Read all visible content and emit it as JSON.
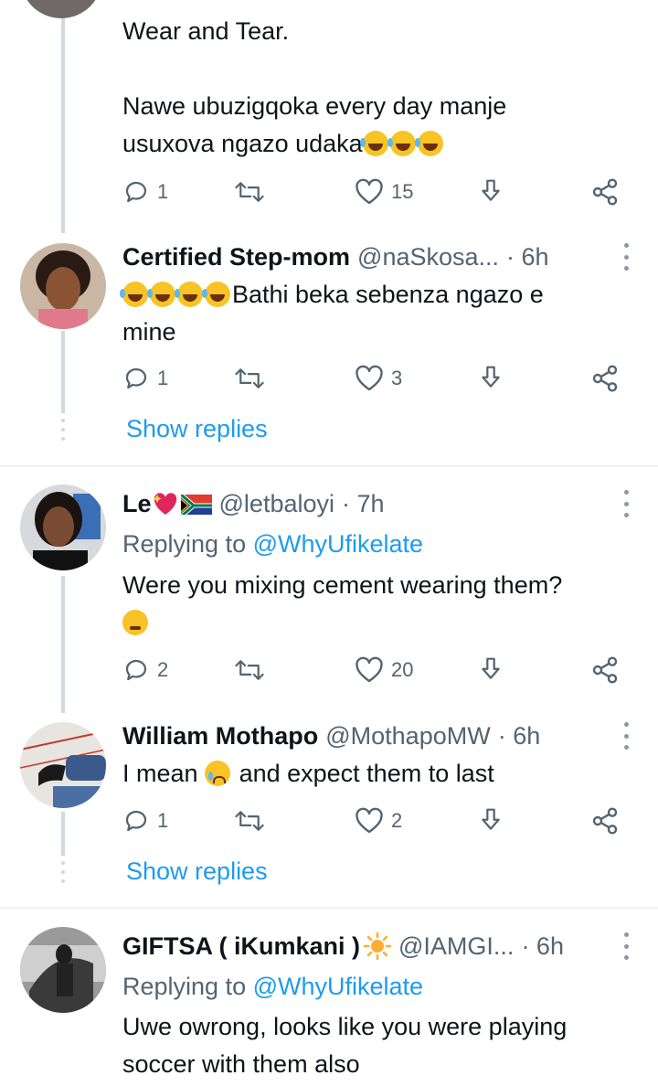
{
  "tweets": [
    {
      "body_lines": [
        "Wear and Tear.",
        "",
        "Nawe ubuzigqoka every day manje",
        "usuxova ngazo udaka"
      ],
      "emoji": [
        "rolling-laughing",
        "rolling-laughing",
        "rolling-laughing"
      ],
      "replies": "1",
      "retweets": "",
      "likes": "15"
    },
    {
      "name": "Certified Step-mom",
      "handle": "@naSkosa...",
      "time": "· 6h",
      "body_emoji": [
        "tears-of-joy",
        "tears-of-joy",
        "tears-of-joy",
        "tears-of-joy"
      ],
      "body_lines": [
        "Bathi beka sebenza ngazo e",
        "mine"
      ],
      "replies": "1",
      "retweets": "",
      "likes": "3",
      "show_replies": "Show replies"
    },
    {
      "name": "Le",
      "handle": "@letbaloyi",
      "time": "· 7h",
      "name_icons": [
        "sparkling-heart",
        "south-africa-flag"
      ],
      "replying_prefix": "Replying to",
      "replying_to": "@WhyUfikelate",
      "body_lines": [
        "Were you mixing cement wearing them?"
      ],
      "body_emoji": [
        "thinking-face"
      ],
      "replies": "2",
      "retweets": "",
      "likes": "20"
    },
    {
      "name": "William Mothapo",
      "handle": "@MothapoMW",
      "time": "· 6h",
      "body_before": "I mean",
      "body_emoji": [
        "crying-face"
      ],
      "body_after": "and expect them to last",
      "replies": "1",
      "retweets": "",
      "likes": "2",
      "show_replies": "Show replies"
    },
    {
      "name": "GIFTSA ( iKumkani )",
      "handle": "@IAMGI...",
      "time": "· 6h",
      "name_icons": [
        "sun"
      ],
      "replying_prefix": "Replying to",
      "replying_to": "@WhyUfikelate",
      "body_lines": [
        "Uwe owrong, looks like you were playing",
        "soccer with them also"
      ]
    }
  ],
  "colors": {
    "accent": "#1d9bf0",
    "secondary_text": "#536471",
    "thread_line": "#cfd9de"
  }
}
